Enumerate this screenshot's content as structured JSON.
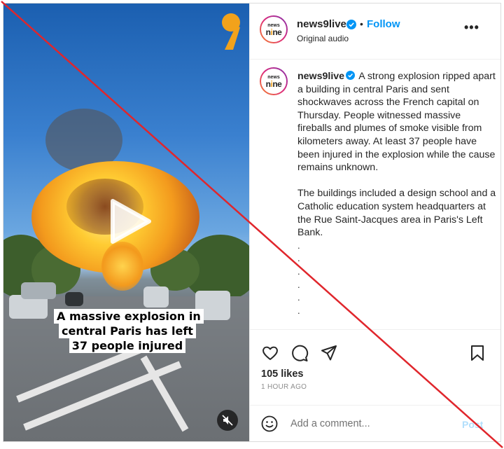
{
  "video": {
    "caption_overlay": "A massive explosion in central Paris has left 37 people injured",
    "play_icon": "play-icon",
    "mute_icon": "muted-speaker-icon",
    "corner_logo": "news9-quote-logo"
  },
  "header": {
    "username": "news9live",
    "verified_icon": "verified-badge-icon",
    "separator": "•",
    "follow_label": "Follow",
    "audio_label": "Original audio",
    "more_label": "•••"
  },
  "avatar": {
    "line1": "news",
    "line2_a": "n",
    "line2_b": "i",
    "line2_c": "ne"
  },
  "post": {
    "username": "news9live",
    "paragraph1": "A strong explosion ripped apart a building in central Paris and sent shockwaves across the French capital on Thursday. People witnessed massive fireballs and plumes of smoke visible from kilometers away. At least 37 people have been injured in the explosion while the cause remains unknown.",
    "paragraph2": "The buildings included a design school and a Catholic education system headquarters at the Rue Saint-Jacques area in Paris's Left Bank.",
    "dots": [
      ".",
      ".",
      ".",
      ".",
      ".",
      "."
    ]
  },
  "actions": {
    "like_icon": "heart-icon",
    "comment_icon": "comment-icon",
    "share_icon": "share-icon",
    "save_icon": "bookmark-icon",
    "likes": "105 likes",
    "time": "1 HOUR AGO"
  },
  "comment": {
    "emoji_icon": "emoji-icon",
    "placeholder": "Add a comment...",
    "post_label": "Post"
  },
  "colors": {
    "accent": "#0095f6",
    "slash": "#e0262c",
    "brand_orange": "#f2a21b"
  }
}
